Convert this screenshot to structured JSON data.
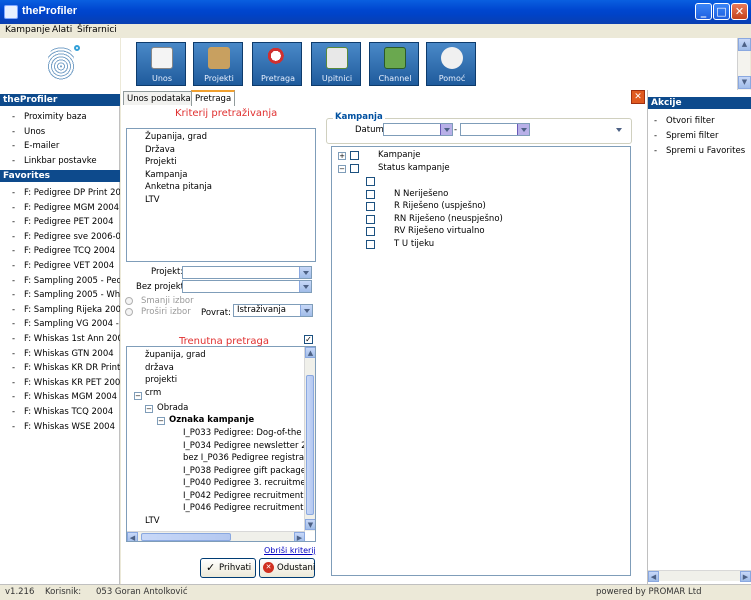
{
  "window": {
    "title": "theProfiler",
    "minimize": "_",
    "maximize": "□",
    "close": "✕"
  },
  "menu": [
    "Kampanje",
    "Alati",
    "Šifrarnici"
  ],
  "toolbar": [
    {
      "label": "Unos",
      "icon": "checklist-icon"
    },
    {
      "label": "Projekti",
      "icon": "boxes-icon"
    },
    {
      "label": "Pretraga",
      "icon": "magnifier-icon"
    },
    {
      "label": "Upitnici",
      "icon": "questionnaire-icon"
    },
    {
      "label": "Channel",
      "icon": "channel-icon"
    },
    {
      "label": "Pomoć",
      "icon": "help-icon"
    }
  ],
  "sidebar": {
    "section1_title": "theProfiler",
    "section1_items": [
      "Proximity baza",
      "Unos",
      "E-mailer",
      "Linkbar postavke"
    ],
    "section2_title": "Favorites",
    "favorites": [
      "F: Pedigree DP Print 2004",
      "F: Pedigree MGM 2004",
      "F: Pedigree PET 2004",
      "F: Pedigree sve 2006-09",
      "F: Pedigree TCQ 2004",
      "F: Pedigree VET 2004",
      "F: Sampling 2005 - Pedigr",
      "F: Sampling 2005 - Whiska",
      "F: Sampling Rijeka 2004 -",
      "F: Sampling VG 2004 - WI",
      "F: Whiskas 1st Ann 2004",
      "F: Whiskas GTN 2004",
      "F: Whiskas KR DR Print 20",
      "F: Whiskas KR PET 2004",
      "F: Whiskas MGM 2004",
      "F: Whiskas TCQ 2004",
      "F: Whiskas WSE 2004"
    ]
  },
  "tabs": [
    {
      "label": "Unos podataka",
      "active": false
    },
    {
      "label": "Pretraga",
      "active": true
    }
  ],
  "kriterij": {
    "title": "Kriterij pretraživanja",
    "items": [
      "Županija, grad",
      "Država",
      "Projekti",
      "Kampanja",
      "Anketna pitanja",
      "LTV"
    ],
    "projekt_label": "Projekt:",
    "projekt_value": "",
    "bez_projekt_label": "Bez projekt",
    "bez_projekt_value": "",
    "smanji_label": "Smanji izbor",
    "prosiri_label": "Proširi izbor",
    "povrat_label": "Povrat:",
    "povrat_value": "Istraživanja"
  },
  "trenutna": {
    "title": "Trenutna pretraga",
    "checked": true,
    "root_items": [
      "županija, grad",
      "država",
      "projekti",
      "crm"
    ],
    "obrada": "Obrada",
    "oznaka": "Oznaka kampanje",
    "campaigns": [
      "I_P033 Pedigree: Dog-of-the m",
      "I_P034 Pedigree newsletter 20",
      "bez I_P036 Pedigree registraci",
      "I_P038 Pedigree gift package",
      "I_P040 Pedigree 3. recruitmen",
      "I_P042 Pedigree recruitment 2",
      "I_P046 Pedigree recruitment 2"
    ],
    "ltv": "LTV",
    "clear_link": "Obriši kriterij",
    "accept": "Prihvati",
    "cancel": "Odustani"
  },
  "kampanja": {
    "title": "Kampanja",
    "datum_label": "Datum:",
    "datum_from": "",
    "datum_to": "",
    "date_separator": "-",
    "tree_root": "Kampanje",
    "status_root": "Status kampanje",
    "statuses": [
      "",
      "N Neriješeno",
      "R Riješeno (uspješno)",
      "RN Riješeno (neuspješno)",
      "RV Riješeno virtualno",
      "T U tijeku"
    ]
  },
  "akcije": {
    "title": "Akcije",
    "items": [
      "Otvori filter",
      "Spremi filter",
      "Spremi u Favorites"
    ]
  },
  "status": {
    "version": "v1.216",
    "user_label": "Korisnik:",
    "user": "053 Goran Antolković",
    "powered": "powered by PROMAR Ltd"
  }
}
